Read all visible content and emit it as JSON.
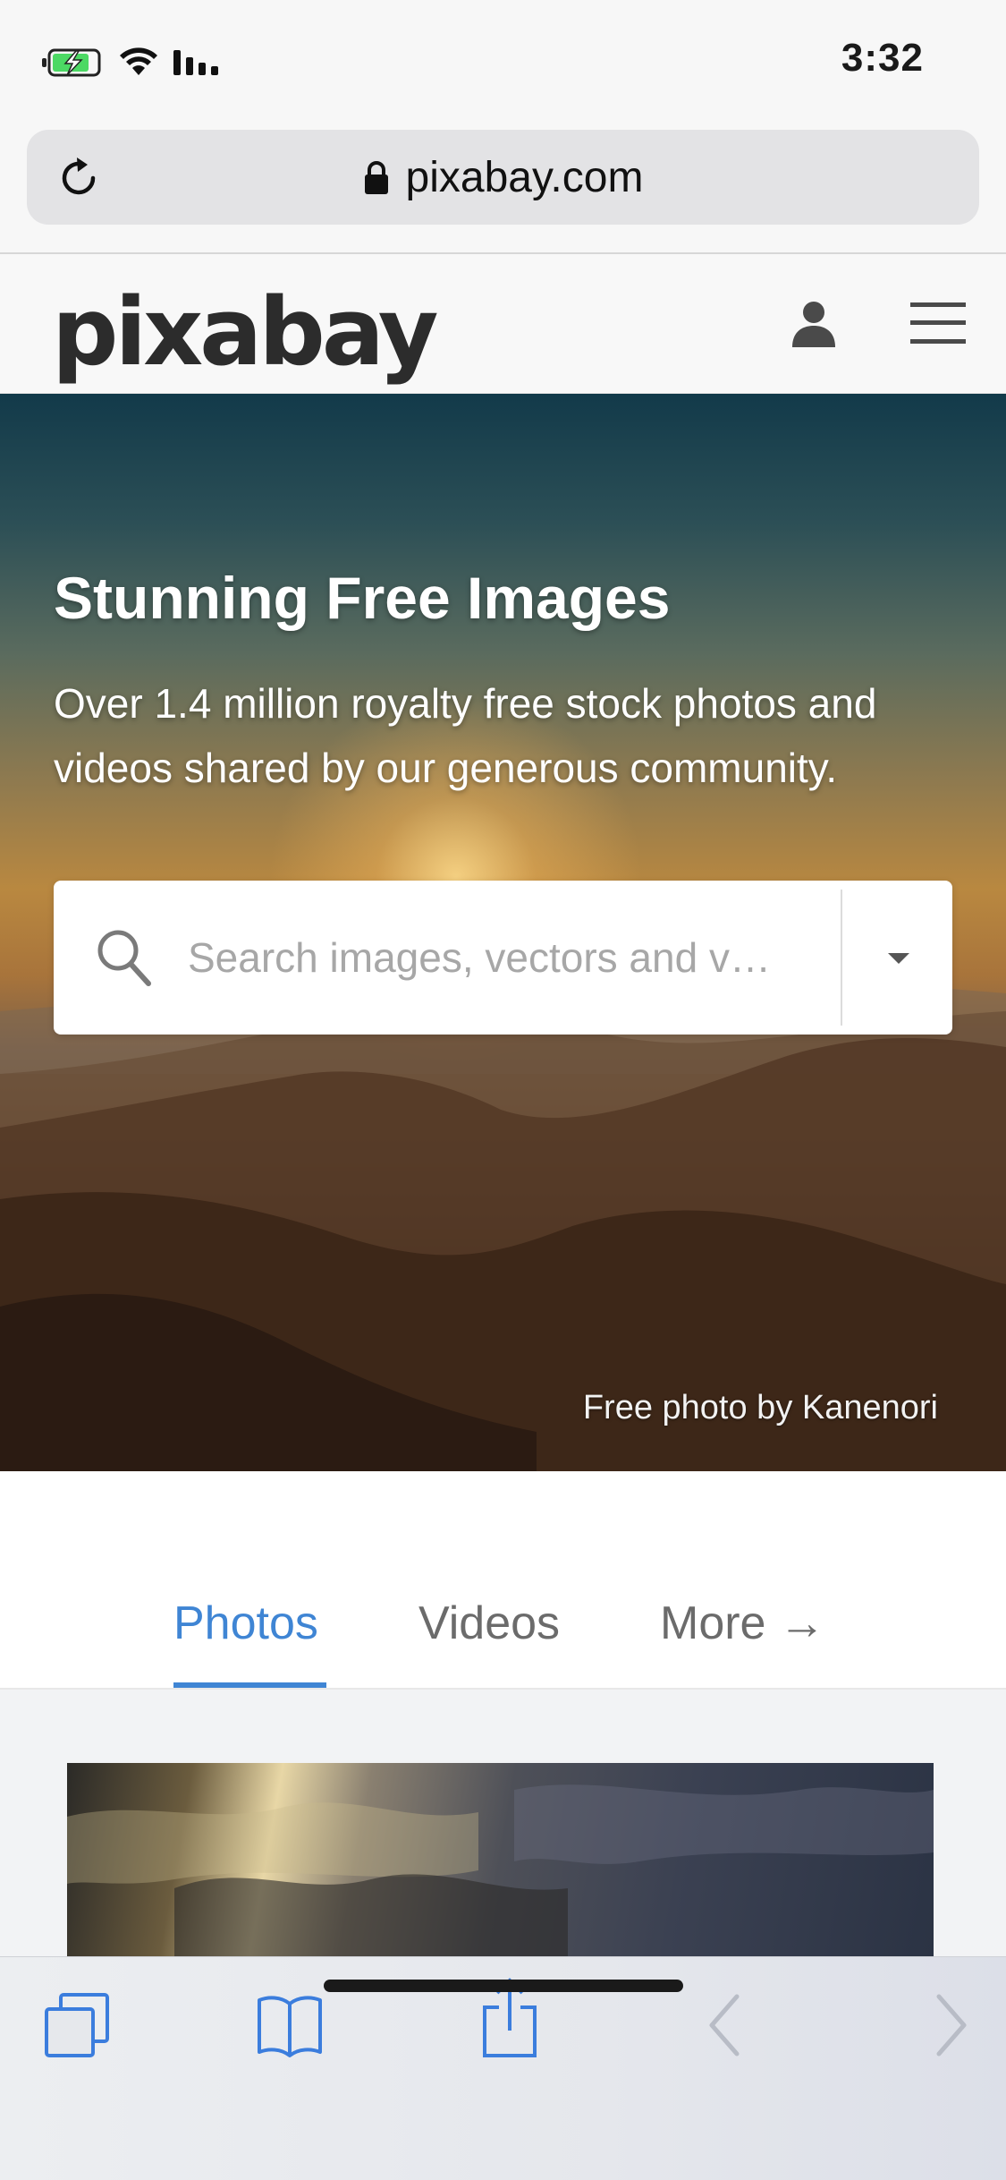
{
  "status_bar": {
    "time": "3:32",
    "icons": [
      "battery-charging-icon",
      "wifi-icon",
      "cellular-signal-icon"
    ]
  },
  "browser": {
    "url": "pixabay.com",
    "icons": [
      "reload-icon",
      "lock-icon"
    ]
  },
  "site_header": {
    "logo_text": "pixabay",
    "icons": [
      "user-icon",
      "hamburger-menu-icon"
    ]
  },
  "hero": {
    "title": "Stunning Free Images",
    "subtitle": "Over 1.4 million royalty free stock photos and videos shared by our generous community.",
    "search_placeholder": "Search images, vectors and v…",
    "search_value": "",
    "credit": "Free photo by Kanenori"
  },
  "tabs": {
    "items": [
      {
        "label": "Photos",
        "active": true
      },
      {
        "label": "Videos",
        "active": false
      },
      {
        "label": "More →",
        "active": false
      }
    ]
  },
  "toolbar": {
    "icons": [
      "tabs-icon",
      "bookmarks-icon",
      "share-icon",
      "back-icon",
      "forward-icon"
    ]
  },
  "colors": {
    "accent": "#3f85d4",
    "ios_blue": "#3b7ddd",
    "disabled": "#b8bcc6"
  }
}
